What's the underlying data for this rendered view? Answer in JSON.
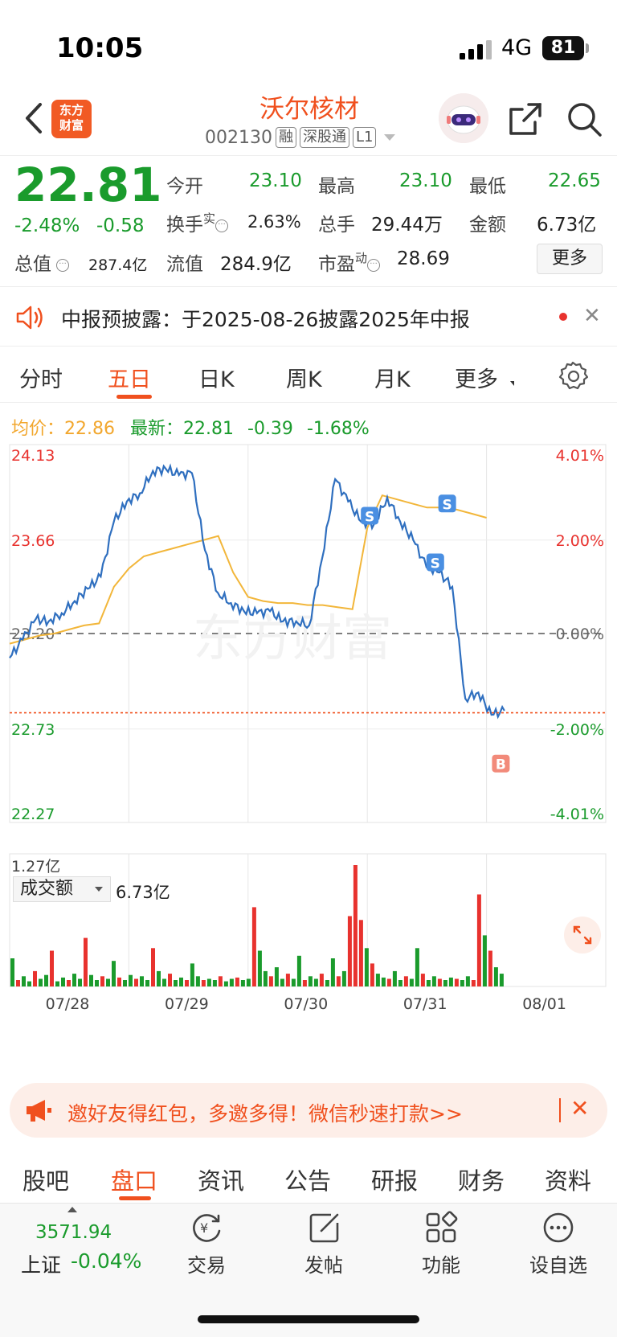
{
  "status": {
    "time": "10:05",
    "network": "4G",
    "battery": "81"
  },
  "header": {
    "logo": "东方财富",
    "name": "沃尔核材",
    "code": "002130",
    "tags": [
      "融",
      "深股通",
      "L1"
    ]
  },
  "quote": {
    "price": "22.81",
    "change_pct": "-2.48%",
    "change_abs": "-0.58",
    "fields": {
      "open_label": "今开",
      "open": "23.10",
      "high_label": "最高",
      "high": "23.10",
      "low_label": "最低",
      "low": "22.65",
      "turnover_label": "换手",
      "turnover_sup": "实",
      "turnover": "2.63%",
      "volume_label": "总手",
      "volume": "29.44万",
      "amount_label": "金额",
      "amount": "6.73亿",
      "mktcap_label": "总值",
      "mktcap": "287.4亿",
      "float_label": "流值",
      "float": "284.9亿",
      "pe_label": "市盈",
      "pe_sup": "动",
      "pe": "28.69"
    },
    "more_button": "更多"
  },
  "notice": {
    "text": "中报预披露：于2025-08-26披露2025年中报"
  },
  "tabs": [
    "分时",
    "五日",
    "日K",
    "周K",
    "月K",
    "更多"
  ],
  "active_tab": "五日",
  "avg_line": {
    "avg_label": "均价：",
    "avg_value": "22.86",
    "latest_label": "最新：",
    "latest_value": "22.81",
    "delta": "-0.39",
    "delta_pct": "-1.68%"
  },
  "colors": {
    "accent": "#f0501e",
    "up": "#e8322e",
    "down": "#1a9b2c",
    "price_line": "#2f6fbf",
    "avg_line": "#f2b63a"
  },
  "chart_data": {
    "type": "line",
    "title": "",
    "x": [
      "07/28",
      "07/29",
      "07/30",
      "07/31",
      "08/01"
    ],
    "y_left_ticks": [
      "24.13",
      "23.66",
      "23.20",
      "22.73",
      "22.27"
    ],
    "y_right_ticks": [
      "4.01%",
      "2.00%",
      "0.00%",
      "-2.00%",
      "-4.01%"
    ],
    "ylim": [
      22.27,
      24.13
    ],
    "baseline": 23.2,
    "series": [
      {
        "values": [
          23.08,
          23.17,
          23.27,
          23.26,
          23.3,
          23.36,
          23.42,
          23.48,
          23.75,
          23.85,
          23.89,
          24.0,
          24.01,
          23.98,
          23.99,
          23.61,
          23.4,
          23.35,
          23.31,
          23.3,
          23.31,
          23.26,
          23.26,
          23.24,
          23.57,
          23.96,
          23.85,
          23.75,
          23.74,
          23.87,
          23.75,
          23.66,
          23.53,
          23.5,
          23.43,
          22.88,
          22.91,
          22.8,
          22.82
        ]
      },
      {
        "values": [
          23.15,
          23.17,
          23.19,
          23.2,
          23.22,
          23.24,
          23.25,
          23.43,
          23.52,
          23.58,
          23.6,
          23.62,
          23.64,
          23.66,
          23.68,
          23.5,
          23.38,
          23.36,
          23.35,
          23.35,
          23.34,
          23.34,
          23.33,
          23.32,
          23.72,
          23.88,
          23.86,
          23.84,
          23.82,
          23.82,
          23.81,
          23.79,
          23.77
        ]
      }
    ],
    "markers": [
      {
        "label": "S"
      },
      {
        "label": "S"
      },
      {
        "label": "S"
      },
      {
        "label": "B"
      }
    ],
    "volume": {
      "label": "成交额",
      "total": "6.73亿",
      "max_label": "1.27亿",
      "bars": [
        0.22,
        0.05,
        0.08,
        0.04,
        0.12,
        0.06,
        0.09,
        0.28,
        0.04,
        0.07,
        0.05,
        0.1,
        0.06,
        0.38,
        0.09,
        0.05,
        0.08,
        0.06,
        0.2,
        0.07,
        0.05,
        0.09,
        0.06,
        0.08,
        0.05,
        0.3,
        0.12,
        0.06,
        0.1,
        0.05,
        0.07,
        0.05,
        0.18,
        0.08,
        0.05,
        0.06,
        0.05,
        0.08,
        0.04,
        0.06,
        0.07,
        0.05,
        0.06,
        0.62,
        0.28,
        0.12,
        0.08,
        0.15,
        0.06,
        0.1,
        0.06,
        0.24,
        0.05,
        0.08,
        0.06,
        0.1,
        0.05,
        0.22,
        0.08,
        0.12,
        0.55,
        0.95,
        0.52,
        0.3,
        0.18,
        0.1,
        0.07,
        0.06,
        0.12,
        0.05,
        0.08,
        0.06,
        0.3,
        0.1,
        0.05,
        0.08,
        0.06,
        0.05,
        0.07,
        0.06,
        0.05,
        0.08,
        0.05,
        0.72,
        0.4,
        0.28,
        0.15,
        0.1
      ]
    }
  },
  "promo": {
    "text": "邀好友得红包，多邀多得！微信秒速打款>>"
  },
  "bottom_tabs": [
    "股吧",
    "盘口",
    "资讯",
    "公告",
    "研报",
    "财务",
    "资料"
  ],
  "active_bottom_tab": "盘口",
  "index": {
    "value": "3571.94",
    "name": "上证",
    "pct": "-0.04%"
  },
  "nav": [
    "交易",
    "发帖",
    "功能",
    "设自选"
  ]
}
